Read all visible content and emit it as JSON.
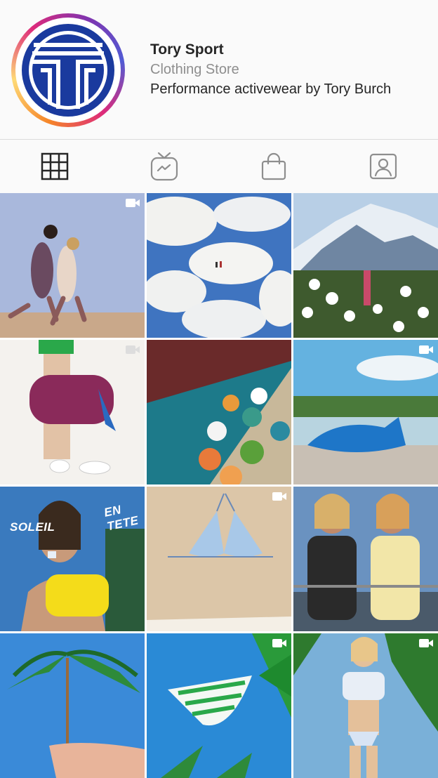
{
  "profile": {
    "name": "Tory Sport",
    "category": "Clothing Store",
    "bio": "Performance activewear by Tory Burch",
    "avatar_icon": "tory-sport-logo-icon",
    "brand_color": "#1a3a9e"
  },
  "tabs": [
    {
      "name": "grid",
      "icon": "grid-icon",
      "active": true
    },
    {
      "name": "igtv",
      "icon": "igtv-icon",
      "active": false
    },
    {
      "name": "shop",
      "icon": "shopping-bag-icon",
      "active": false
    },
    {
      "name": "tagged",
      "icon": "tagged-user-icon",
      "active": false
    }
  ],
  "posts": [
    {
      "subject": "two women running on sand",
      "video": true
    },
    {
      "subject": "aerial snowfield with hikers",
      "video": false
    },
    {
      "subject": "mountain with daisies",
      "video": false
    },
    {
      "subject": "person carrying duffel bag",
      "video": true
    },
    {
      "subject": "beach umbrellas aerial",
      "video": false
    },
    {
      "subject": "whale shaped bag on beach",
      "video": true
    },
    {
      "subject": "woman in yellow top",
      "video": false,
      "overlay_texts": [
        "SOLEIL",
        "EN TETE"
      ]
    },
    {
      "subject": "striped bikini top on sand",
      "video": true
    },
    {
      "subject": "two women at railing",
      "video": false
    },
    {
      "subject": "palm leaf umbrella",
      "video": false
    },
    {
      "subject": "striped bikini bottom with palms",
      "video": true
    },
    {
      "subject": "woman in swimsuit with palms",
      "video": true
    }
  ]
}
